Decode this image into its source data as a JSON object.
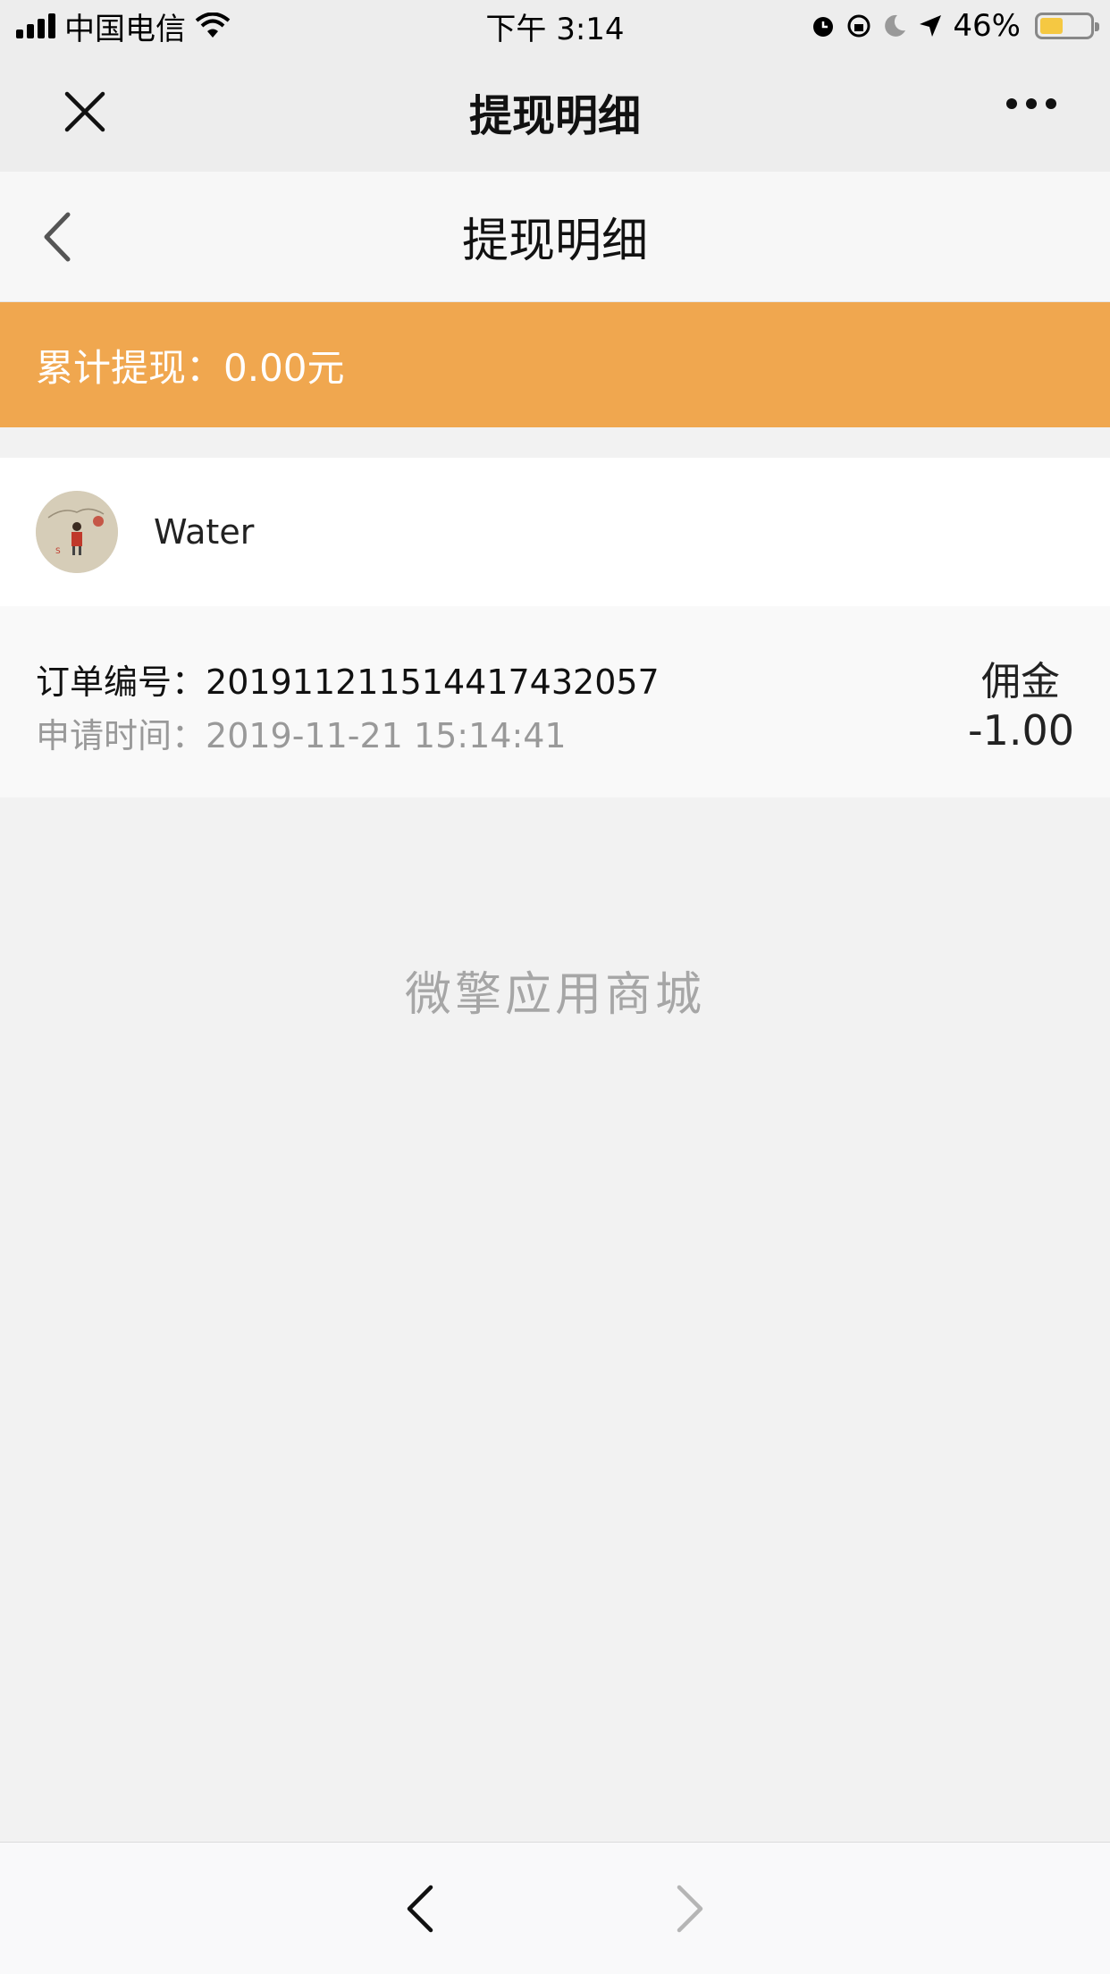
{
  "status_bar": {
    "carrier": "中国电信",
    "time": "下午 3:14",
    "battery": "46%",
    "battery_level": 0.46
  },
  "wechat_header": {
    "title": "提现明细",
    "close_icon": "close-icon",
    "more_icon": "more-icon"
  },
  "page_header": {
    "title": "提现明细",
    "back_icon": "chevron-left-icon"
  },
  "summary": {
    "text": "累计提现：0.00元"
  },
  "user": {
    "name": "Water"
  },
  "records": [
    {
      "order_label": "订单编号：",
      "order_number": "20191121151441743​2057",
      "time_label": "申请时间：",
      "time": "2019-11-21 15:14:41",
      "type": "佣金",
      "amount": "-1.00"
    }
  ],
  "footer": {
    "brand": "微擎应用商城"
  },
  "bottom_nav": {
    "back_icon": "chevron-left-icon",
    "forward_icon": "chevron-right-icon"
  },
  "colors": {
    "banner": "#f0a74f",
    "header_bg": "#ededed",
    "battery_fill": "#f5c842"
  }
}
